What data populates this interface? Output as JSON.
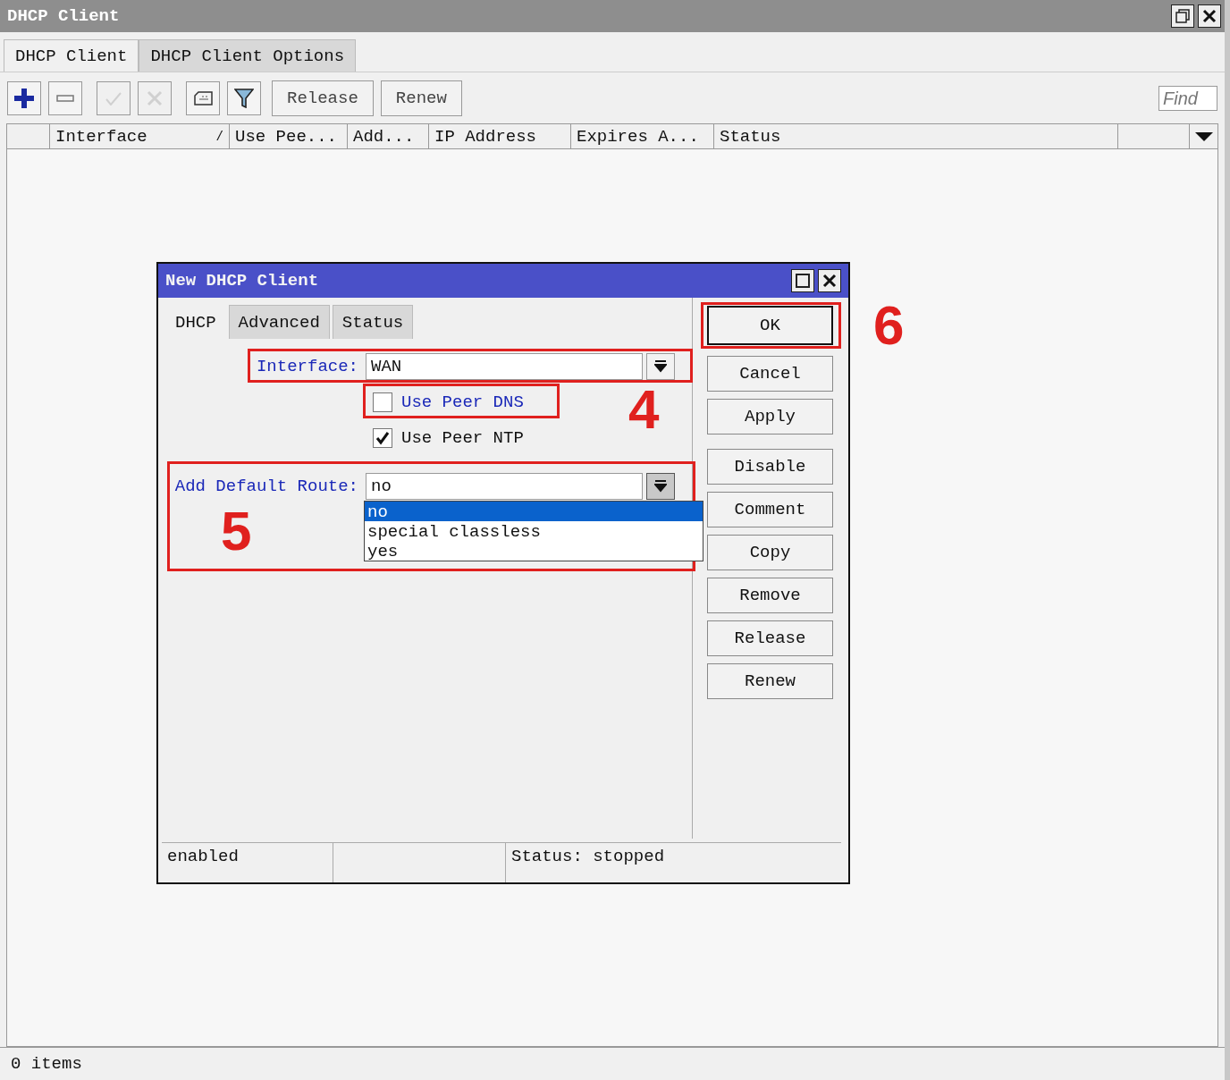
{
  "window": {
    "title": "DHCP Client"
  },
  "tabs": [
    {
      "label": "DHCP Client",
      "selected": true
    },
    {
      "label": "DHCP Client Options",
      "selected": false
    }
  ],
  "toolbar": {
    "icon_buttons": [
      {
        "kind": "add",
        "disabled": false
      },
      {
        "kind": "remove",
        "disabled": false
      },
      {
        "kind": "enable",
        "disabled": true
      },
      {
        "kind": "disable",
        "disabled": true
      },
      {
        "kind": "comment",
        "disabled": false
      },
      {
        "kind": "filter",
        "disabled": false
      }
    ],
    "buttons": [
      "Release",
      "Renew"
    ],
    "find": {
      "placeholder": "Find"
    }
  },
  "table": {
    "columns": [
      {
        "label": "Interface",
        "sort_mark": "/"
      },
      {
        "label": "Use Pee..."
      },
      {
        "label": "Add..."
      },
      {
        "label": "IP Address"
      },
      {
        "label": "Expires A..."
      },
      {
        "label": "Status"
      }
    ]
  },
  "status_bar": "0 items",
  "dialog": {
    "title": "New DHCP Client",
    "tabs": [
      {
        "label": "DHCP",
        "selected": true
      },
      {
        "label": "Advanced",
        "selected": false
      },
      {
        "label": "Status",
        "selected": false
      }
    ],
    "interface": {
      "label": "Interface:",
      "value": "WAN",
      "highlighted": true
    },
    "checkboxes": [
      {
        "label": "Use Peer DNS",
        "checked": false,
        "highlighted": true
      },
      {
        "label": "Use Peer NTP",
        "checked": true,
        "highlighted": false
      }
    ],
    "default_route": {
      "label": "Add Default Route:",
      "value": "no",
      "highlighted": true,
      "expanded": true,
      "options": [
        {
          "label": "no",
          "selected": true
        },
        {
          "label": "special classless",
          "selected": false
        },
        {
          "label": "yes",
          "selected": false
        }
      ]
    },
    "buttons": [
      {
        "label": "OK",
        "default": true
      },
      {
        "label": "Cancel",
        "default": false
      },
      {
        "label": "Apply",
        "default": false
      },
      {
        "label": "Disable",
        "default": false
      },
      {
        "label": "Comment",
        "default": false
      },
      {
        "label": "Copy",
        "default": false
      },
      {
        "label": "Remove",
        "default": false
      },
      {
        "label": "Release",
        "default": false
      },
      {
        "label": "Renew",
        "default": false
      }
    ],
    "status_bar": [
      "enabled",
      "Status:  stopped"
    ]
  },
  "annotations": [
    {
      "label": "4"
    },
    {
      "label": "5"
    },
    {
      "label": "6"
    }
  ]
}
